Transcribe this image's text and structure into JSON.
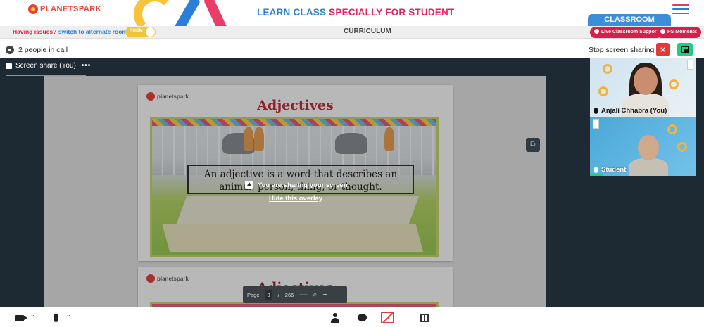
{
  "header": {
    "logo_text": "PLANETSPARK",
    "headline_part1": "LEARN CLASS",
    "headline_part2": "SPECIALLY FOR STUDENT",
    "classroom_tab": "CLASSROOM"
  },
  "subbar": {
    "issues_text": "Having issues?",
    "switch_text": "switch to alternate room",
    "room_toggle_label": "ROOM",
    "curriculum": "CURRICULUM",
    "support_button": "Live Classroom Support",
    "moments_button": "PS Moments"
  },
  "meeting": {
    "people_count": "2 people in call",
    "stop_sharing": "Stop screen sharing",
    "stop_icon": "×",
    "screen_share_tab": "Screen share (You)",
    "tab_menu": "•••"
  },
  "slides": [
    {
      "logo_text": "planetspark",
      "title": "Adjectives",
      "definition": "An adjective is a word that describes an animal, person, thing, or thought."
    },
    {
      "logo_text": "planetspark",
      "title": "Adjectives"
    }
  ],
  "overlay": {
    "message": "You are sharing your screen",
    "hide_link": "Hide this overlay"
  },
  "pagebar": {
    "page_label": "Page",
    "current_page": "9",
    "separator": "/",
    "total_pages": "266",
    "zoom_out": "—",
    "zoom_icon": "⌕",
    "zoom_in": "+"
  },
  "participants": [
    {
      "name": "Anjali Chhabra (You)"
    },
    {
      "name": "Student"
    }
  ],
  "controls": {
    "camera_chevron": "⌄",
    "mic_chevron": "⌄"
  },
  "colors": {
    "brand_red": "#e0245e",
    "brand_blue": "#2b7fd4",
    "share_green": "#1fce84",
    "stop_red": "#e53935"
  }
}
